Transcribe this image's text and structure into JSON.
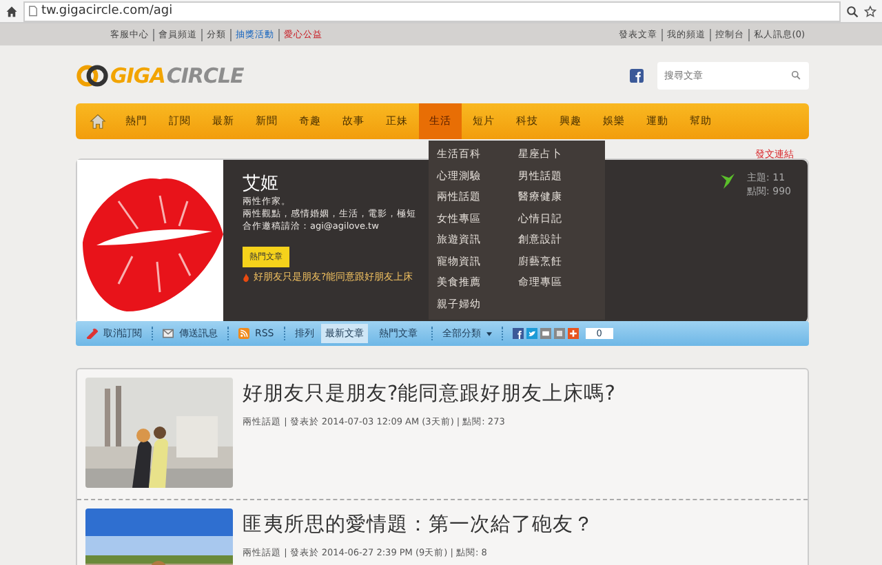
{
  "browser": {
    "url": "tw.gigacircle.com/agi"
  },
  "top_links_left": [
    {
      "label": "客服中心",
      "kind": "plain"
    },
    {
      "label": "會員頻道",
      "kind": "plain"
    },
    {
      "label": "分類",
      "kind": "plain"
    },
    {
      "label": "抽獎活動",
      "kind": "blue"
    },
    {
      "label": "愛心公益",
      "kind": "red"
    }
  ],
  "top_links_right": [
    "發表文章",
    "我的頻道",
    "控制台",
    "私人訊息(0)"
  ],
  "logo": {
    "part1": "GIGA",
    "part2": "CIRCLE"
  },
  "search": {
    "placeholder": "搜尋文章"
  },
  "nav": [
    {
      "label": "熱門",
      "selected": false
    },
    {
      "label": "訂閱",
      "selected": false
    },
    {
      "label": "最新",
      "selected": false
    },
    {
      "label": "新聞",
      "selected": false
    },
    {
      "label": "奇趣",
      "selected": false
    },
    {
      "label": "故事",
      "selected": false
    },
    {
      "label": "正妹",
      "selected": false
    },
    {
      "label": "生活",
      "selected": true
    },
    {
      "label": "短片",
      "selected": false
    },
    {
      "label": "科技",
      "selected": false
    },
    {
      "label": "興趣",
      "selected": false
    },
    {
      "label": "娛樂",
      "selected": false
    },
    {
      "label": "運動",
      "selected": false
    },
    {
      "label": "幫助",
      "selected": false
    }
  ],
  "dropdown": [
    "生活百科",
    "星座占卜",
    "心理測驗",
    "男性話題",
    "兩性話題",
    "醫療健康",
    "女性專區",
    "心情日記",
    "旅遊資訊",
    "創意設計",
    "寵物資訊",
    "廚藝烹飪",
    "美食推薦",
    "命理專區",
    "親子婦幼"
  ],
  "profile": {
    "name": "艾姬",
    "lines": [
      "兩性作家。",
      "兩性觀點，感情婚姻，生活，電影，極短",
      "合作邀稿請洽：agi@agilove.tw"
    ],
    "hot_button": "熱門文章",
    "hot_post": "好朋友只是朋友?能同意跟好朋友上床",
    "post_link": "發文連結",
    "stats": [
      "主題: 11",
      "點閱: 990"
    ]
  },
  "toolbar": {
    "unsubscribe": "取消訂閱",
    "message": "傳送訊息",
    "rss": "RSS",
    "sort_label": "排列",
    "sort": [
      {
        "label": "最新文章",
        "selected": true
      },
      {
        "label": "熱門文章",
        "selected": false
      }
    ],
    "category": "全部分類",
    "share_count": "0"
  },
  "articles": [
    {
      "title": "好朋友只是朋友?能同意跟好朋友上床嗎?",
      "meta": "兩性話題 | 發表於 2014-07-03 12:09 AM (3天前) | 點閱: 273"
    },
    {
      "title": "匪夷所思的愛情題：第一次給了砲友？",
      "meta": "兩性話題 | 發表於 2014-06-27 2:39 PM (9天前) | 點閱: 8"
    }
  ]
}
